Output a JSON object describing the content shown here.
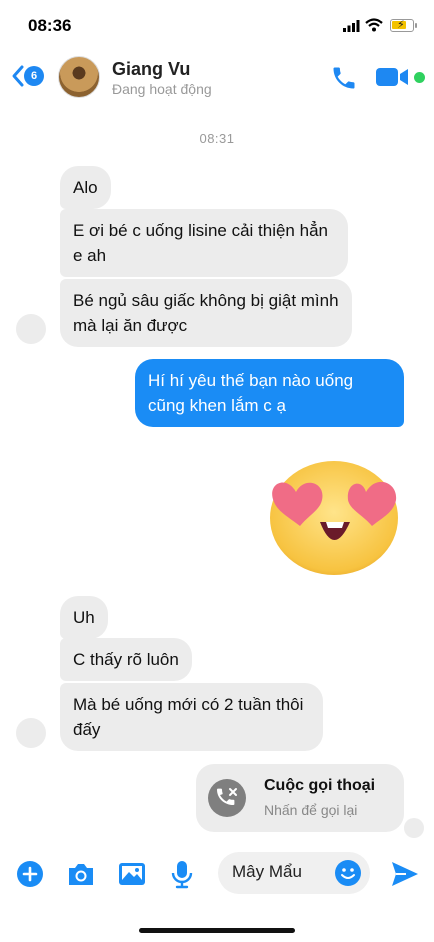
{
  "status": {
    "time": "08:36"
  },
  "header": {
    "back_badge": "6",
    "contact_name": "Giang Vu",
    "presence": "Đang hoạt động"
  },
  "conversation": {
    "timestamp": "08:31",
    "incoming_group_1": [
      "Alo",
      "E ơi bé c uống lisine cải thiện hẳn e ah",
      "Bé ngủ sâu giấc không bị giật mình mà lại ăn được"
    ],
    "outgoing": "Hí hí yêu thế bạn nào uống cũng khen lắm c ạ",
    "sticker": "heart-eyes-emoji",
    "incoming_group_2": [
      "Uh",
      "C thấy rõ luôn",
      "Mà bé uống mới có 2 tuần thôi đấy"
    ],
    "call_card": {
      "title": "Cuộc gọi thoại",
      "subtitle": "Nhấn để gọi lại"
    }
  },
  "composer": {
    "input_value": "Mây Mẩu",
    "icons": [
      "plus-icon",
      "camera-icon",
      "image-icon",
      "microphone-icon",
      "smile-icon",
      "send-icon"
    ]
  },
  "colors": {
    "accent": "#1a8cf5",
    "incoming_bubble": "#ececec",
    "online": "#2fd15f"
  }
}
